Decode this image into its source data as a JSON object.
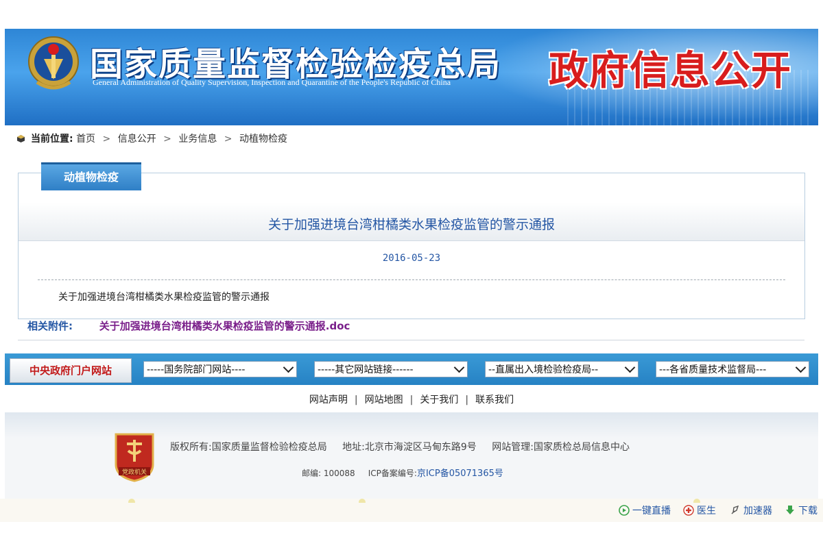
{
  "header": {
    "title_cn": "国家质量监督检验检疫总局",
    "title_en": "General Administration of Quality Supervision, Inspection and Quarantine of the People's Republic of China",
    "gov_open": "政府信息公开",
    "emblem_icon": "national-emblem-icon"
  },
  "breadcrumb": {
    "label": "当前位置:",
    "items": [
      "首页",
      "信息公开",
      "业务信息",
      "动植物检疫"
    ],
    "separator": ">"
  },
  "panel": {
    "tab_label": "动植物检疫",
    "title": "关于加强进境台湾柑橘类水果检疫监管的警示通报",
    "date": "2016-05-23",
    "body": "关于加强进境台湾柑橘类水果检疫监管的警示通报"
  },
  "attachment": {
    "label": "相关附件:",
    "file": "关于加强进境台湾柑橘类水果检疫监管的警示通报.doc"
  },
  "nav": {
    "central_portal": "中央政府门户网站",
    "selects": [
      "-----国务院部门网站----",
      "-----其它网站链接------",
      "--直属出入境检验检疫局--",
      "---各省质量技术监督局---"
    ]
  },
  "footer": {
    "links": [
      "网站声明",
      "网站地图",
      "关于我们",
      "联系我们"
    ],
    "copyright": "版权所有:国家质量监督检验检疫总局",
    "address": "地址:北京市海淀区马甸东路9号",
    "admin": "网站管理:国家质检总局信息中心",
    "postcode": "邮编: 100088",
    "icp_label": "ICP备案编号:",
    "icp": "京ICP备05071365号",
    "badge_text": "党政机关"
  },
  "statusbar": {
    "items": [
      "一键直播",
      "医生",
      "加速器",
      "下载"
    ]
  },
  "colors": {
    "banner": "#2e86d6",
    "accent_red": "#d81d1d",
    "link_blue": "#2456a4",
    "attachment_purple": "#7a1f8a"
  }
}
